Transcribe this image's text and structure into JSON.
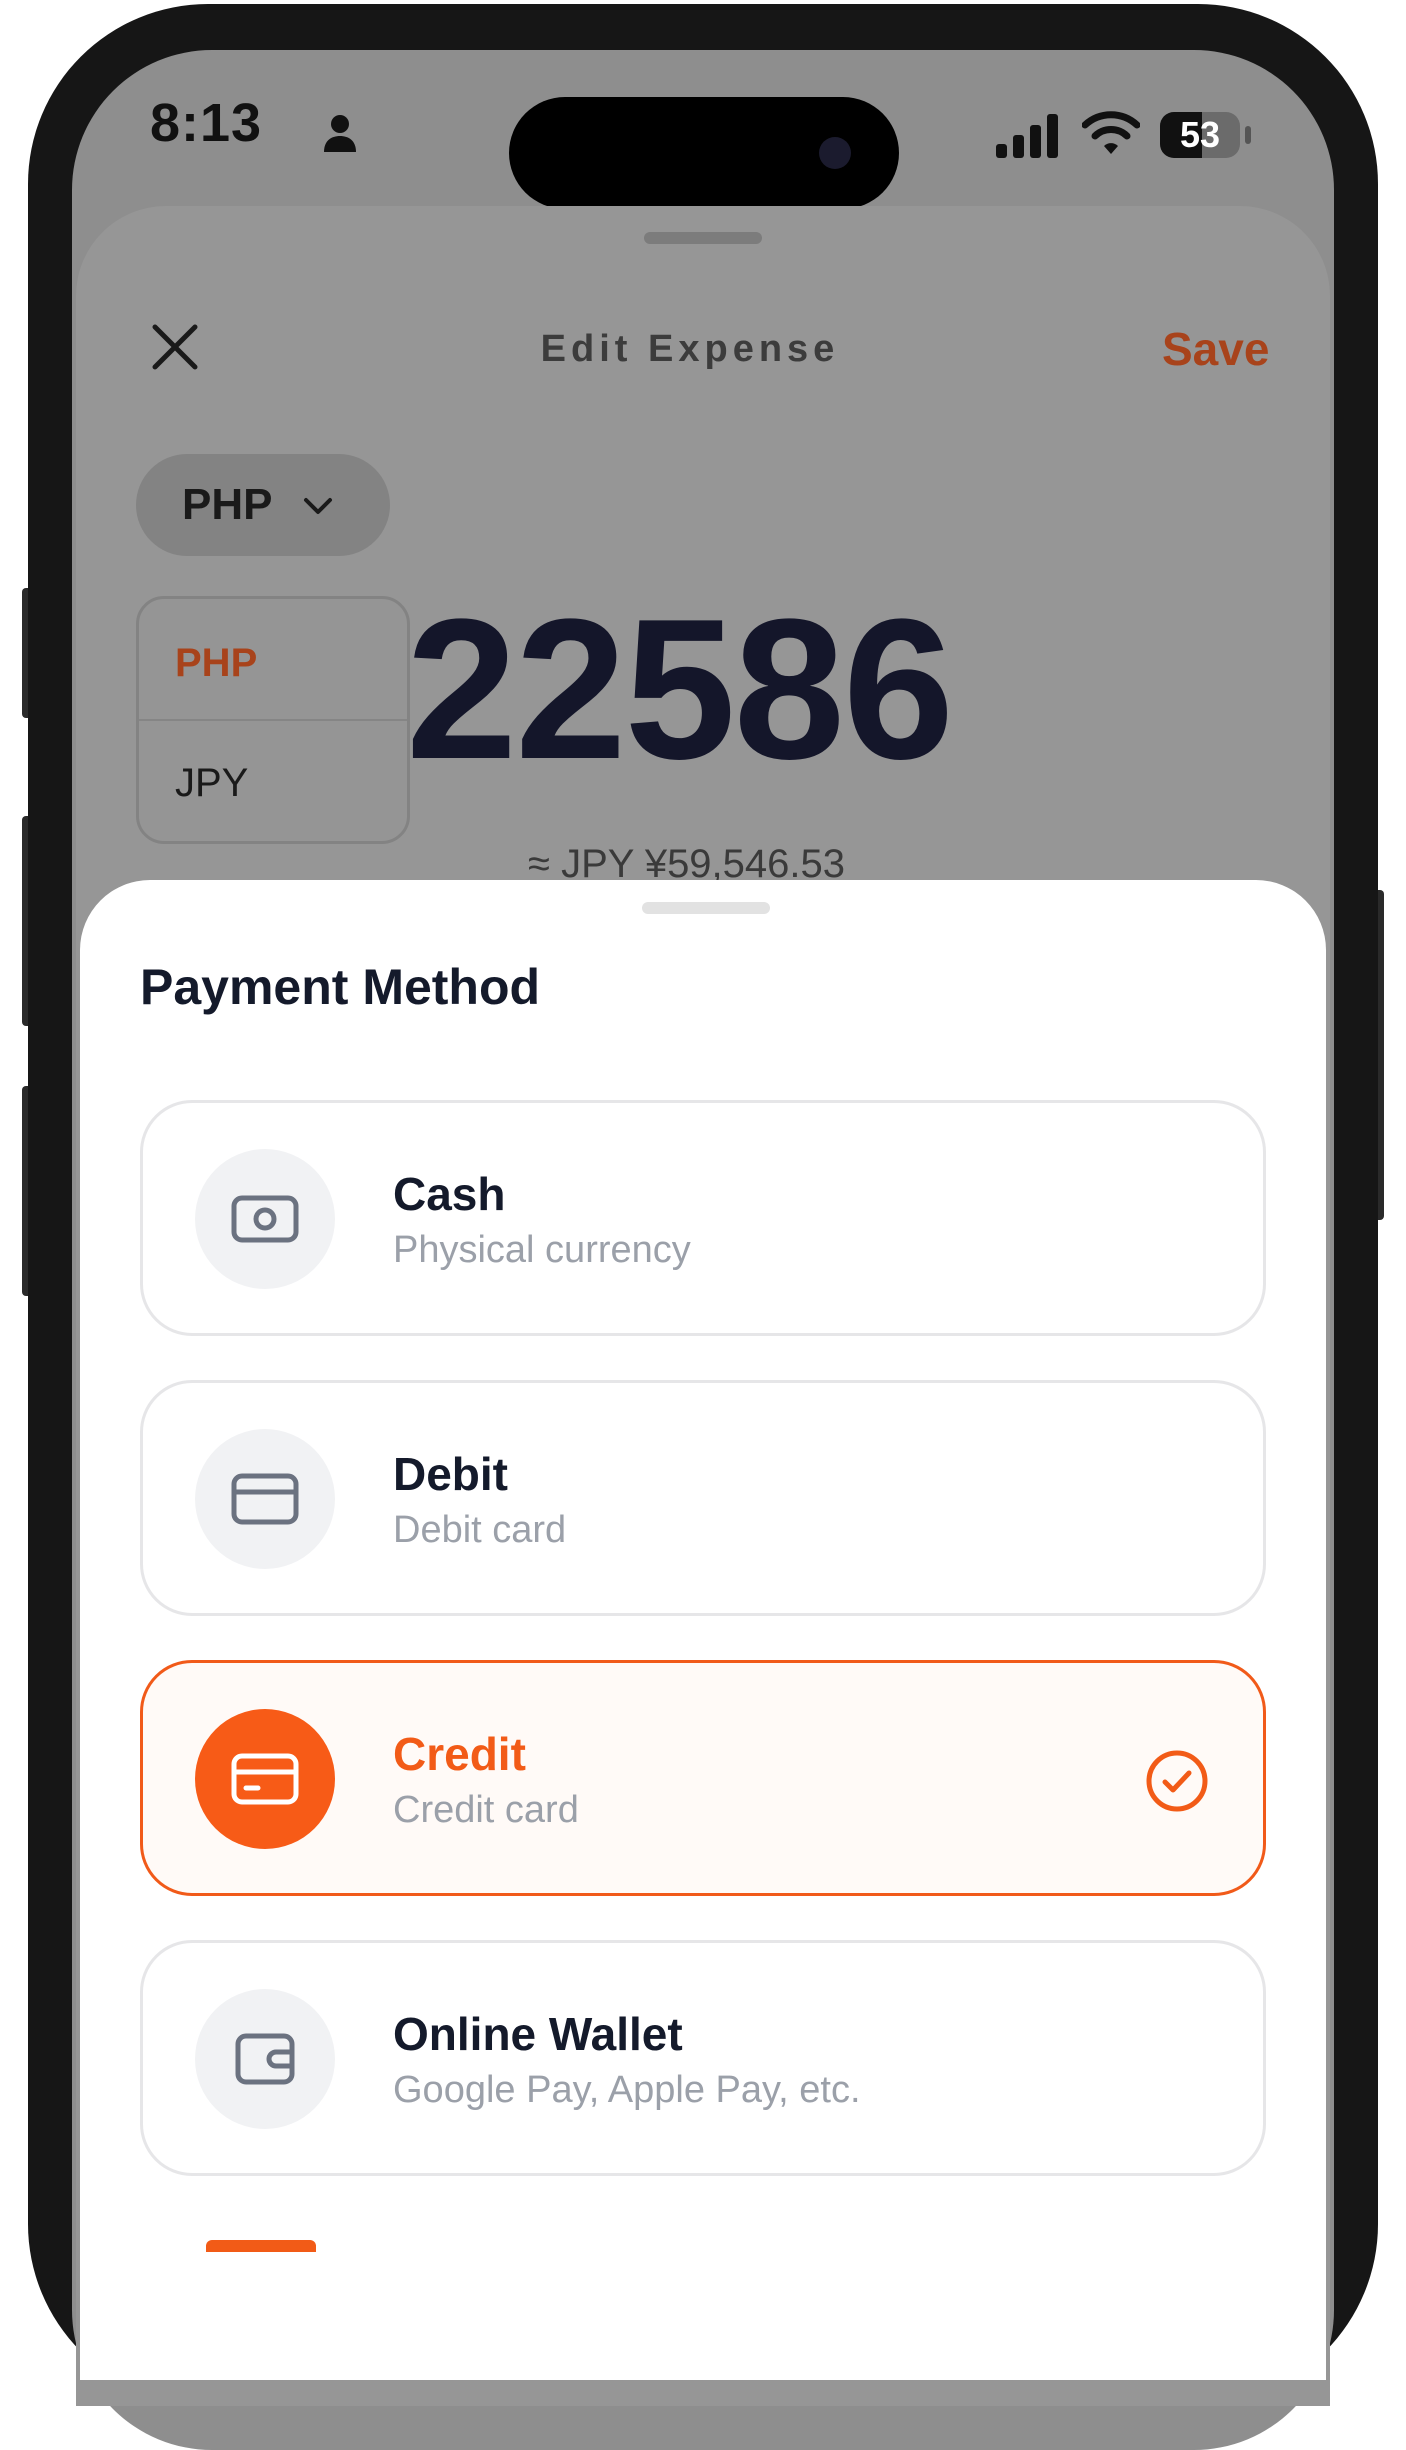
{
  "status_bar": {
    "time": "8:13",
    "battery": "53"
  },
  "header": {
    "title": "Edit Expense",
    "save_label": "Save"
  },
  "currency_selector": {
    "selected": "PHP",
    "options": [
      "PHP",
      "JPY"
    ]
  },
  "amount": {
    "value": "22586",
    "converted": "≈ JPY ¥59,546.53"
  },
  "payment_sheet": {
    "title": "Payment Method",
    "options": [
      {
        "label": "Cash",
        "description": "Physical currency",
        "icon": "cash-icon",
        "selected": false
      },
      {
        "label": "Debit",
        "description": "Debit card",
        "icon": "debit-card-icon",
        "selected": false
      },
      {
        "label": "Credit",
        "description": "Credit card",
        "icon": "credit-card-icon",
        "selected": true
      },
      {
        "label": "Online Wallet",
        "description": "Google Pay, Apple Pay, etc.",
        "icon": "wallet-icon",
        "selected": false
      }
    ]
  },
  "colors": {
    "accent": "#F25B17",
    "save_dimmed": "#A8431B",
    "text_primary": "#141A2B",
    "text_secondary": "#9BA0A9"
  }
}
